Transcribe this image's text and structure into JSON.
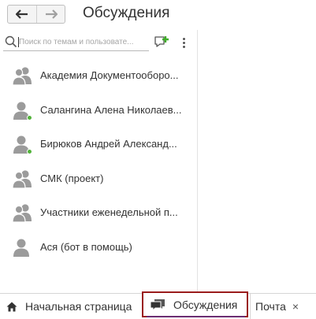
{
  "header": {
    "back_icon": "arrow-left-icon",
    "forward_icon": "arrow-right-icon",
    "title": "Обсуждения"
  },
  "search": {
    "placeholder": "Поиск по темам и пользовате...",
    "value": "",
    "icon": "search-icon"
  },
  "toolbar": {
    "add_icon": "new-chat-icon",
    "more_icon": "more-vertical-icon",
    "accent": "#3fae29"
  },
  "discussions": [
    {
      "label": "Академия Документооборо...",
      "avatar": "group-icon",
      "online": false
    },
    {
      "label": "Салангина Алена Николаев...",
      "avatar": "user-icon",
      "online": true
    },
    {
      "label": "Бирюков Андрей Александ...",
      "avatar": "user-icon",
      "online": true
    },
    {
      "label": "СМК (проект)",
      "avatar": "group-icon",
      "online": false
    },
    {
      "label": "Участники еженедельной п...",
      "avatar": "group-icon",
      "online": false
    },
    {
      "label": "Ася (бот в помощь)",
      "avatar": "user-icon",
      "online": false
    }
  ],
  "tabs": {
    "home": {
      "label": "Начальная страница",
      "icon": "home-icon"
    },
    "discussions": {
      "label": "Обсуждения",
      "icon": "chat-icon",
      "active": true
    },
    "mail": {
      "label": "Почта",
      "close": "×"
    }
  },
  "colors": {
    "online": "#52b33b",
    "active_tab_border": "#9a1c1c",
    "active_tab_underline": "#6b2d72",
    "avatar": "#9b9b9b"
  }
}
